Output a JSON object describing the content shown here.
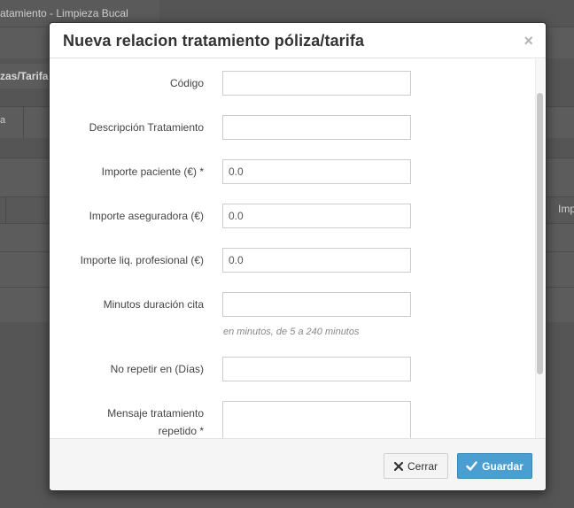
{
  "background": {
    "breadcrumb": "atamiento - Limpieza Bucal",
    "tab_label": "zas/Tarifa",
    "col_a": "a",
    "col_imp": "Imp"
  },
  "modal": {
    "title": "Nueva relacion tratamiento póliza/tarifa",
    "close": "×",
    "fields": {
      "codigo": {
        "label": "Código",
        "value": ""
      },
      "descripcion": {
        "label": "Descripción Tratamiento",
        "value": ""
      },
      "importe_paciente": {
        "label": "Importe paciente (€) *",
        "value": "0.0"
      },
      "importe_aseguradora": {
        "label": "Importe aseguradora (€)",
        "value": "0.0"
      },
      "importe_liq": {
        "label": "Importe liq. profesional (€)",
        "value": "0.0"
      },
      "minutos": {
        "label": "Minutos duración cita",
        "value": "",
        "hint": "en minutos, de 5 a 240 minutos"
      },
      "no_repetir": {
        "label": "No repetir en (Días)",
        "value": ""
      },
      "mensaje_line1": "Mensaje tratamiento",
      "mensaje_line2": "repetido *"
    },
    "footer": {
      "cancel_label": "Cerrar",
      "save_label": "Guardar"
    }
  },
  "colors": {
    "primary": "#4a9fd0",
    "overlay": "#555555"
  },
  "icons": {
    "close": "close-icon",
    "cancel": "x-icon",
    "save": "check-icon"
  }
}
